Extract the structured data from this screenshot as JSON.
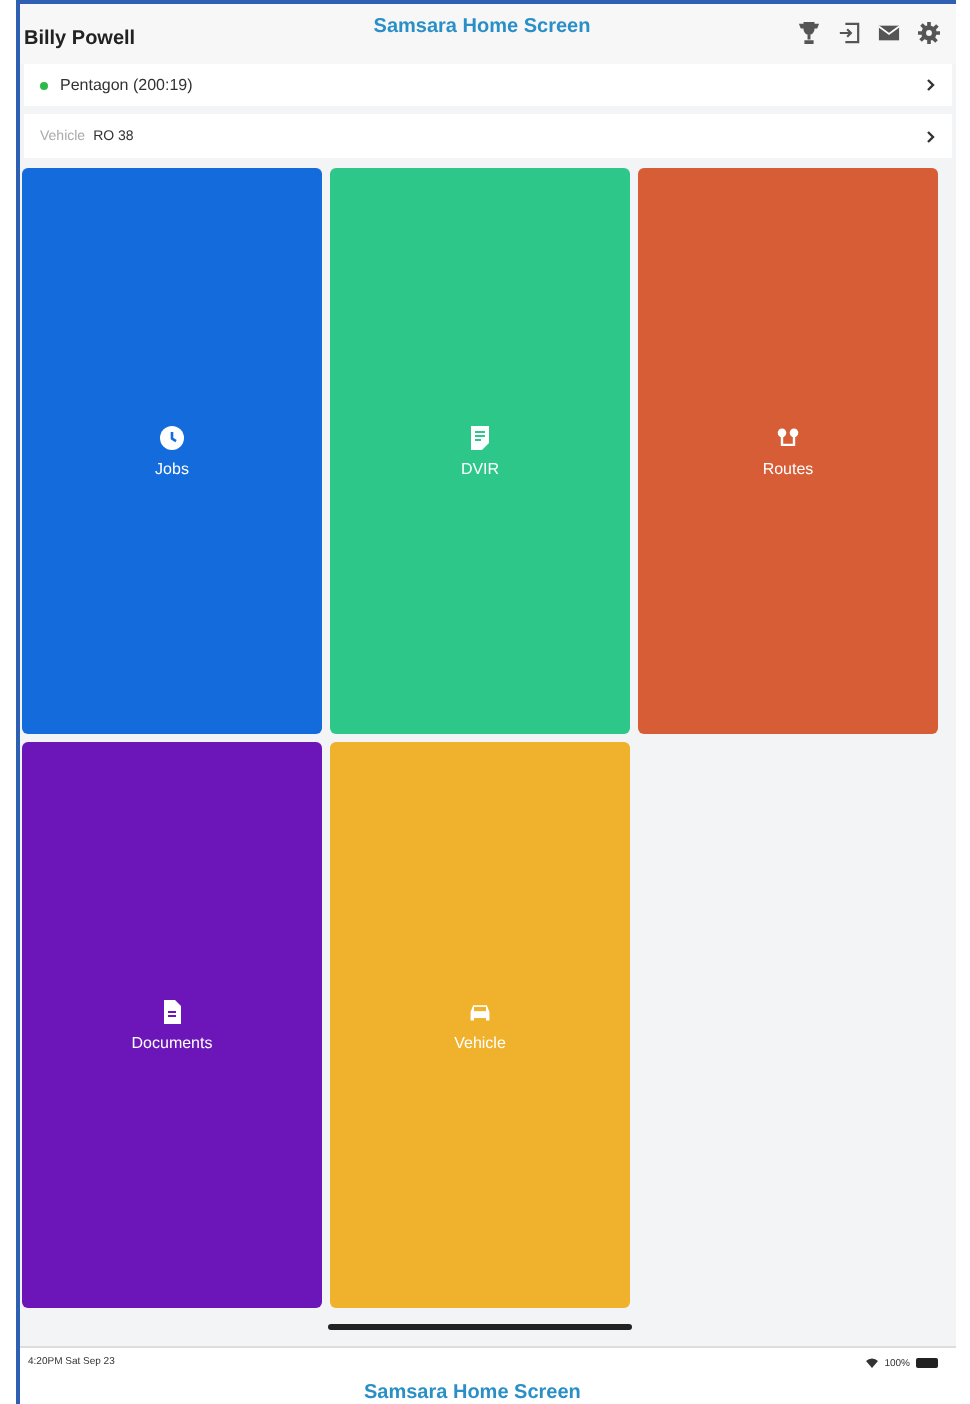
{
  "header": {
    "user": "Billy Powell",
    "title": "Samsara Home Screen"
  },
  "rows": [
    {
      "kind": "status",
      "label": "Pentagon (200:19)",
      "color": "#2fb84a"
    },
    {
      "kind": "field",
      "label": "Vehicle",
      "value": "RO 38"
    }
  ],
  "tiles": [
    {
      "label": "Jobs",
      "kind": "clock",
      "color": "#136bdc"
    },
    {
      "label": "DVIR",
      "kind": "report",
      "color": "#2dc78a"
    },
    {
      "label": "Routes",
      "kind": "routes",
      "color": "#d65d36"
    },
    {
      "label": "Documents",
      "kind": "document",
      "color": "#6c15b9"
    },
    {
      "label": "Vehicle",
      "kind": "car",
      "color": "#f0b22c"
    }
  ],
  "status_bar": {
    "time": "4:20PM  Sat Sep 23",
    "battery": "100%"
  },
  "next_title": "Samsara Home Screen"
}
